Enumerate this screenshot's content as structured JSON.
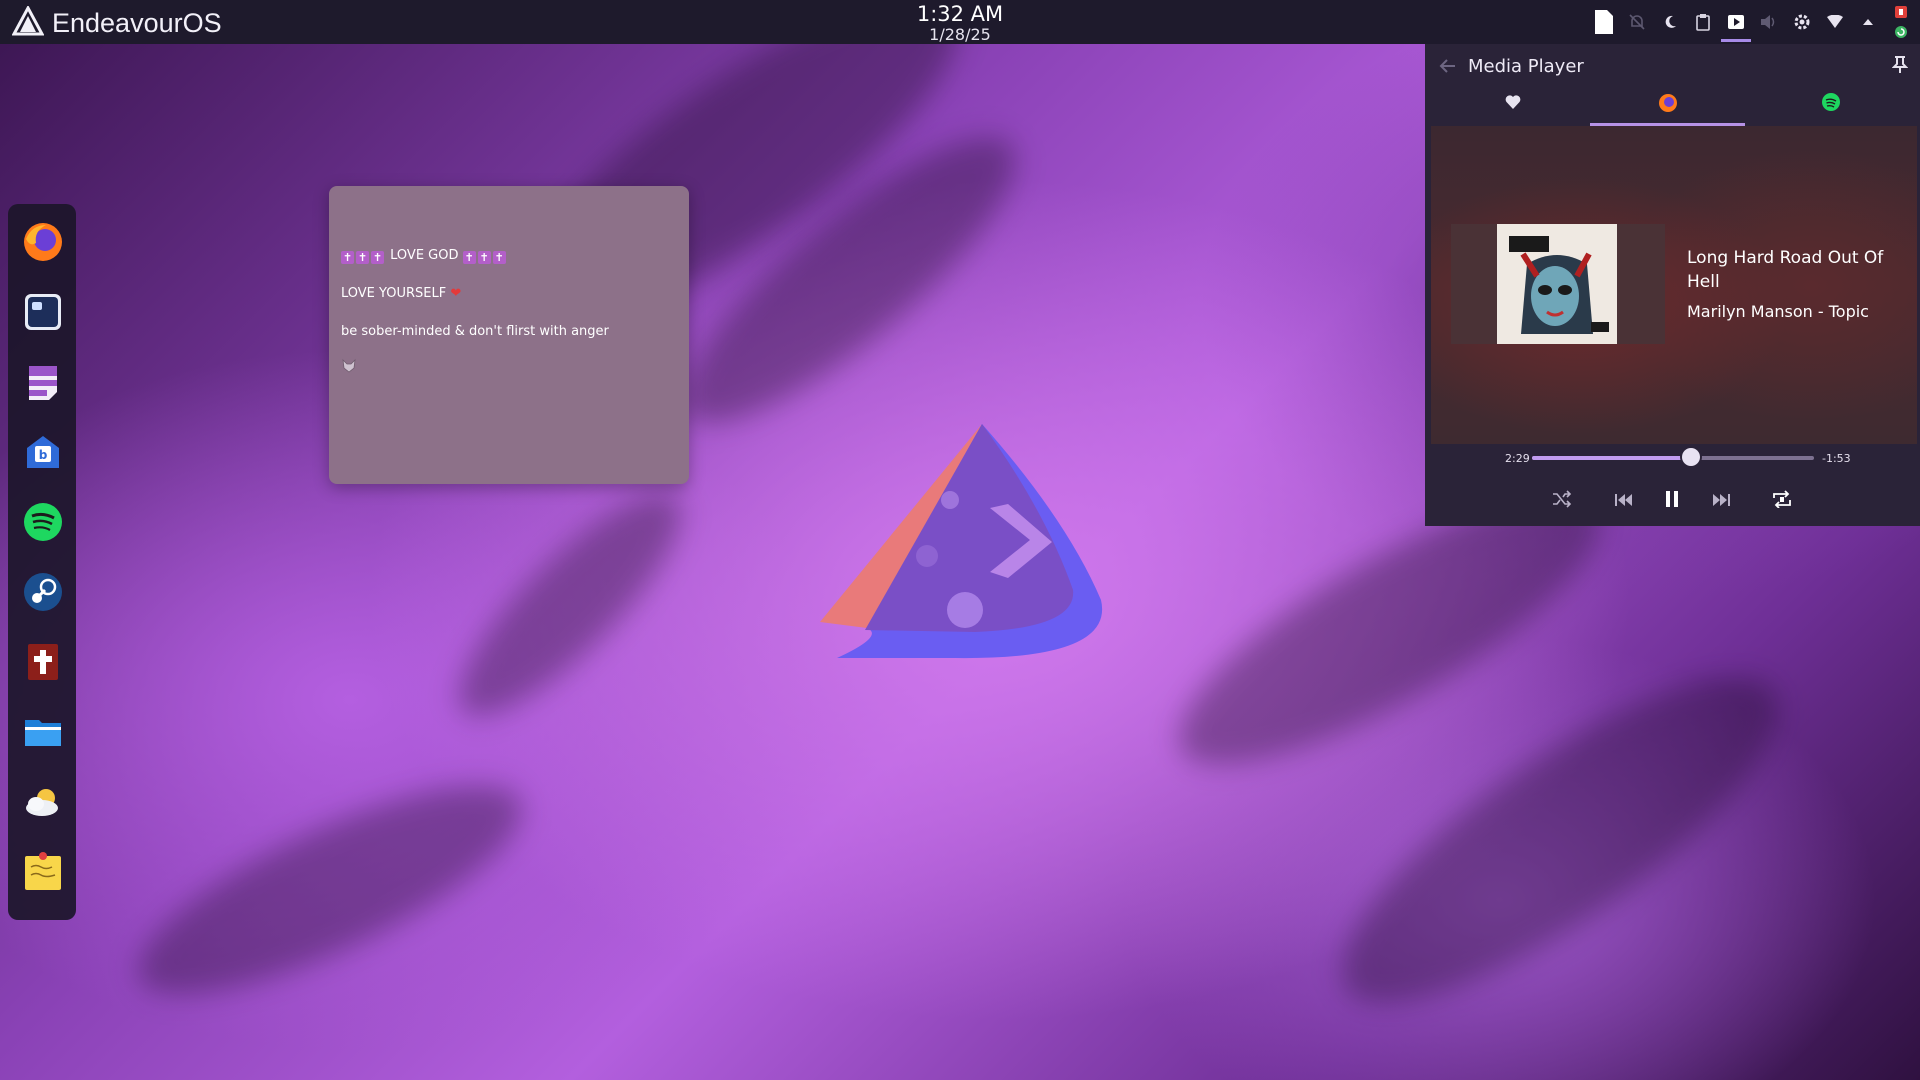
{
  "topbar": {
    "brand_name": "EndeavourOS",
    "clock_time": "1:32 AM",
    "clock_date": "1/28/25",
    "tray_icons": [
      "document-icon",
      "no-notifications-icon",
      "night-mode-icon",
      "clipboard-icon",
      "media-player-icon",
      "volume-icon",
      "settings-icon",
      "network-icon",
      "arrow-up-icon",
      "update-icon"
    ]
  },
  "dock": {
    "items": [
      "firefox-icon",
      "terminal-icon",
      "notes-app-icon",
      "mail-app-icon",
      "spotify-icon",
      "steam-icon",
      "bible-app-icon",
      "file-manager-icon",
      "weather-icon",
      "sticky-notes-icon"
    ]
  },
  "note": {
    "line1_text": "LOVE GOD",
    "line2_text": "LOVE YOURSELF",
    "line3_text": "be sober-minded & don't flirst with anger"
  },
  "media_player": {
    "title": "Media Player",
    "tabs": [
      "heart-icon",
      "firefox-icon",
      "spotify-icon"
    ],
    "selected_tab": 1,
    "track_title": "Long Hard Road Out Of Hell",
    "artist": "Marilyn Manson - Topic",
    "elapsed": "2:29",
    "remaining": "-1:53",
    "progress": 0.565,
    "accent": "#b692e6"
  }
}
